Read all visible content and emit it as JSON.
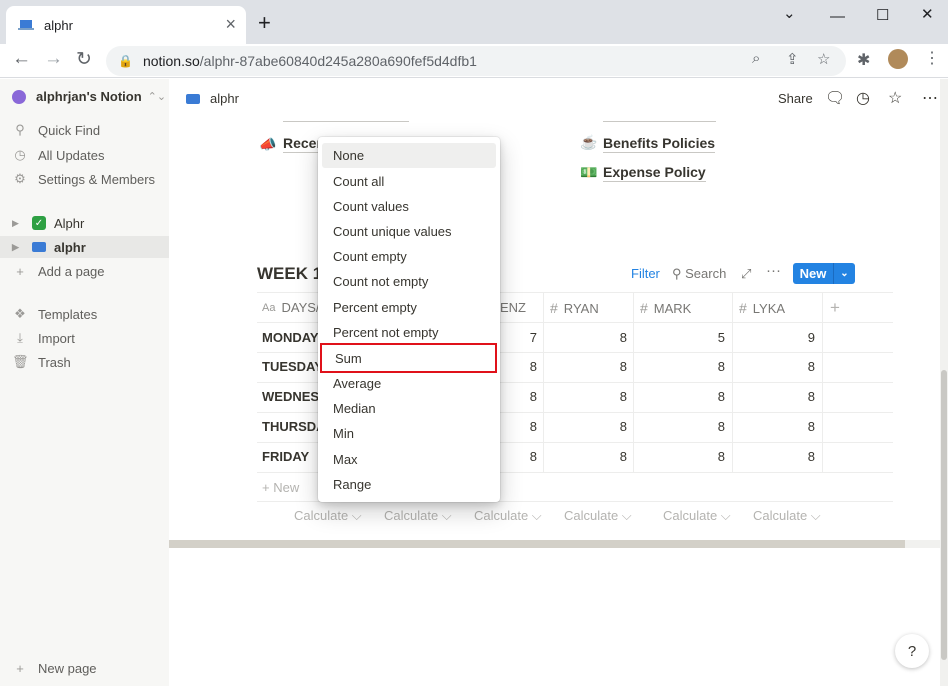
{
  "browser": {
    "tab_title": "alphr",
    "new_tab_symbol": "+",
    "url_host": "notion.so",
    "url_path": "/alphr-87abe60840d245a280a690fef5d4dfb1"
  },
  "sidebar": {
    "workspace": "alphrjan's Notion",
    "nav": [
      "Quick Find",
      "All Updates",
      "Settings & Members"
    ],
    "pages": [
      "Alphr",
      "alphr"
    ],
    "add_page": "Add a page",
    "tools": [
      "Templates",
      "Import",
      "Trash"
    ],
    "new_page": "New page"
  },
  "topbar": {
    "page_title": "alphr",
    "share": "Share"
  },
  "content": {
    "links": {
      "left": "Recen",
      "right1": "Benefits Policies",
      "right2": "Expense Policy"
    }
  },
  "database": {
    "title": "WEEK 1",
    "view": {
      "filter": "Filter",
      "search": "Search",
      "more": "···",
      "new": "New"
    },
    "columns": [
      "DAYS/D",
      "ENZ",
      "RYAN",
      "MARK",
      "LYKA"
    ],
    "rows": [
      {
        "day": "MONDAY",
        "values": [
          "7",
          "8",
          "5",
          "9"
        ]
      },
      {
        "day": "TUESDAY",
        "values": [
          "8",
          "8",
          "8",
          "8"
        ]
      },
      {
        "day": "WEDNESD",
        "values": [
          "8",
          "8",
          "8",
          "8"
        ]
      },
      {
        "day": "THURSDA",
        "values": [
          "8",
          "8",
          "8",
          "8"
        ]
      },
      {
        "day": "FRIDAY",
        "values": [
          "8",
          "8",
          "8",
          "8"
        ]
      }
    ],
    "new_row": "+ New",
    "calculate": "Calculate ⌵"
  },
  "dropdown": {
    "items": [
      "None",
      "Count all",
      "Count values",
      "Count unique values",
      "Count empty",
      "Count not empty",
      "Percent empty",
      "Percent not empty",
      "Sum",
      "Average",
      "Median",
      "Min",
      "Max",
      "Range"
    ],
    "highlighted": "Sum"
  },
  "colors": {
    "accent": "#2383e2",
    "highlight_box": "#e0111a"
  }
}
